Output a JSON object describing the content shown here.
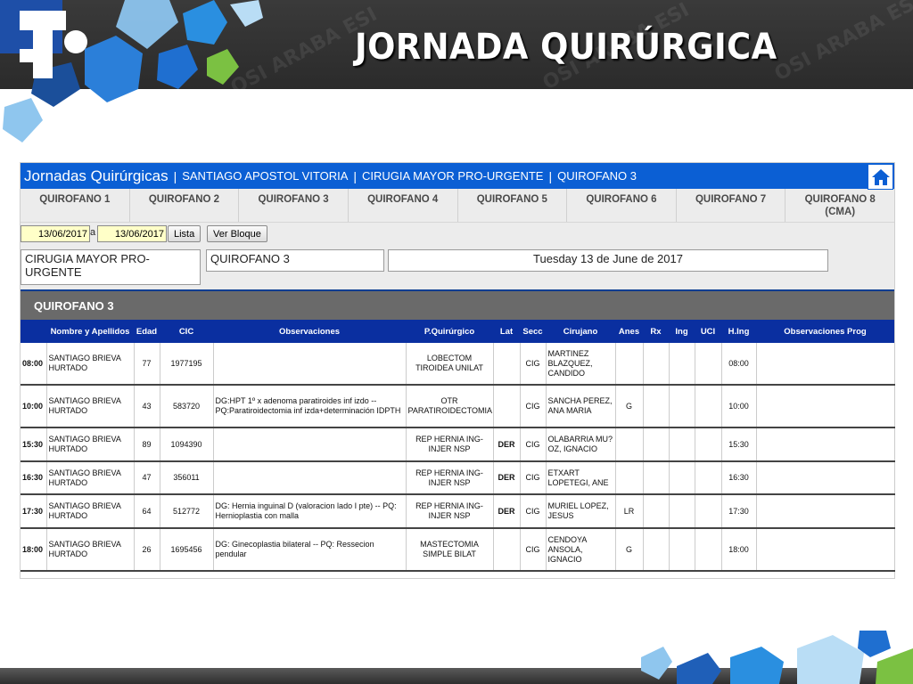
{
  "slide": {
    "title": "JORNADA QUIRÚRGICA",
    "watermark": "OSI ARABA ESI"
  },
  "app": {
    "name": "Jornadas Quirúrgicas",
    "breadcrumb": [
      "SANTIAGO APOSTOL VITORIA",
      "CIRUGIA MAYOR PRO-URGENTE",
      "QUIROFANO 3"
    ],
    "home_icon": "home-icon",
    "accent_color": "#0b5fd4"
  },
  "tabs": [
    {
      "label": "QUIROFANO 1"
    },
    {
      "label": "QUIROFANO 2"
    },
    {
      "label": "QUIROFANO 3"
    },
    {
      "label": "QUIROFANO 4"
    },
    {
      "label": "QUIROFANO 5"
    },
    {
      "label": "QUIROFANO 6"
    },
    {
      "label": "QUIROFANO 7"
    },
    {
      "label": "QUIROFANO 8\n(CMA)"
    }
  ],
  "controls": {
    "date_from": "13/06/2017",
    "date_sep": "a",
    "date_to": "13/06/2017",
    "lista_label": "Lista",
    "ver_bloque_label": "Ver Bloque",
    "service": "CIRUGIA MAYOR PRO-URGENTE",
    "room": "QUIROFANO 3",
    "date_long": "Tuesday 13 de June de 2017"
  },
  "section_title": "QUIROFANO 3",
  "table": {
    "headers": [
      "",
      "Nombre y Apellidos",
      "Edad",
      "CIC",
      "Observaciones",
      "P.Quirúrgico",
      "Lat",
      "Secc",
      "Cirujano",
      "Anes",
      "Rx",
      "Ing",
      "UCI",
      "H.Ing",
      "Observaciones Prog"
    ],
    "rows": [
      {
        "time": "08:00",
        "name": "SANTIAGO BRIEVA HURTADO",
        "age": "77",
        "cic": "1977195",
        "obs": "",
        "proc": "LOBECTOM TIROIDEA UNILAT",
        "lat": "",
        "secc": "CIG",
        "surgeon": "MARTINEZ BLAZQUEZ, CANDIDO",
        "anes": "",
        "rx": "",
        "ing": "",
        "uci": "",
        "hing": "08:00",
        "obs_prog": ""
      },
      {
        "time": "10:00",
        "name": "SANTIAGO BRIEVA HURTADO",
        "age": "43",
        "cic": "583720",
        "obs": "DG:HPT 1º x adenoma paratiroides inf izdo -- PQ:Paratiroidectomia inf izda+determinación IDPTH",
        "proc": "OTR PARATIROIDECTOMIA",
        "lat": "",
        "secc": "CIG",
        "surgeon": "SANCHA PEREZ, ANA MARIA",
        "anes": "G",
        "rx": "",
        "ing": "",
        "uci": "",
        "hing": "10:00",
        "obs_prog": ""
      },
      {
        "time": "15:30",
        "name": "SANTIAGO BRIEVA HURTADO",
        "age": "89",
        "cic": "1094390",
        "obs": "",
        "proc": "REP HERNIA ING-INJER NSP",
        "lat": "DER",
        "secc": "CIG",
        "surgeon": "OLABARRIA MU?OZ, IGNACIO",
        "anes": "",
        "rx": "",
        "ing": "",
        "uci": "",
        "hing": "15:30",
        "obs_prog": ""
      },
      {
        "time": "16:30",
        "name": "SANTIAGO BRIEVA HURTADO",
        "age": "47",
        "cic": "356011",
        "obs": "",
        "proc": "REP HERNIA ING-INJER NSP",
        "lat": "DER",
        "secc": "CIG",
        "surgeon": "ETXART LOPETEGI, ANE",
        "anes": "",
        "rx": "",
        "ing": "",
        "uci": "",
        "hing": "16:30",
        "obs_prog": ""
      },
      {
        "time": "17:30",
        "name": "SANTIAGO BRIEVA HURTADO",
        "age": "64",
        "cic": "512772",
        "obs": "DG: Hernia inguinal D (valoracion lado I pte) -- PQ: Hernioplastia con malla",
        "proc": "REP HERNIA ING-INJER NSP",
        "lat": "DER",
        "secc": "CIG",
        "surgeon": "MURIEL LOPEZ, JESUS",
        "anes": "LR",
        "rx": "",
        "ing": "",
        "uci": "",
        "hing": "17:30",
        "obs_prog": ""
      },
      {
        "time": "18:00",
        "name": "SANTIAGO BRIEVA HURTADO",
        "age": "26",
        "cic": "1695456",
        "obs": "DG: Ginecoplastia bilateral -- PQ: Ressecion pendular",
        "proc": "MASTECTOMIA SIMPLE BILAT",
        "lat": "",
        "secc": "CIG",
        "surgeon": "CENDOYA ANSOLA, IGNACIO",
        "anes": "G",
        "rx": "",
        "ing": "",
        "uci": "",
        "hing": "18:00",
        "obs_prog": ""
      }
    ]
  }
}
